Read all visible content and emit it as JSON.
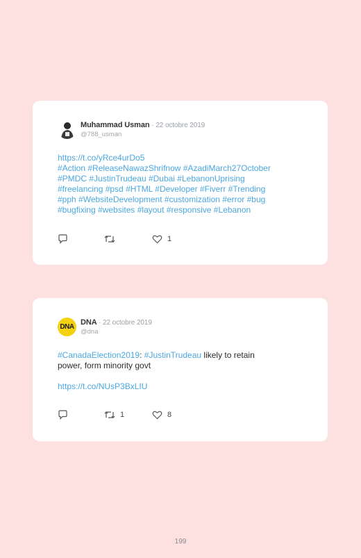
{
  "tweets": [
    {
      "author": "Muhammad Usman",
      "date": "· 22 octobre 2019",
      "handle": "@788_usman",
      "lines": [
        "https://t.co/yRce4urDo5",
        "#Action #ReleaseNawazShrifnow #AzadiMarch27October",
        "#PMDC #JustinTrudeau #Dubai #LebanonUprising",
        "#freelancing #psd #HTML #Developer #Fiverr #Trending",
        "#pph #WebsiteDevelopment #customization #error #bug",
        "#bugfixing #websites #layout #responsive #Lebanon"
      ],
      "retweets": "",
      "likes": "1"
    },
    {
      "author": "DNA",
      "date": "· 22 octobre 2019",
      "handle": "@dna",
      "avatar_text": "DNA",
      "text_link1": "#CanadaElection2019",
      "text_sep": ": ",
      "text_link2": "#JustinTrudeau",
      "text_rest1": " likely to retain",
      "text_line2": "power, form minority govt",
      "text_url": "https://t.co/NUsP3BxLIU",
      "retweets": "1",
      "likes": "8"
    }
  ],
  "page_number": "199",
  "colors": {
    "background": "#fde0e0",
    "link": "#4aa7e0",
    "dna_yellow": "#f5d20f"
  },
  "icons": [
    "reply-icon",
    "retweet-icon",
    "like-icon"
  ]
}
